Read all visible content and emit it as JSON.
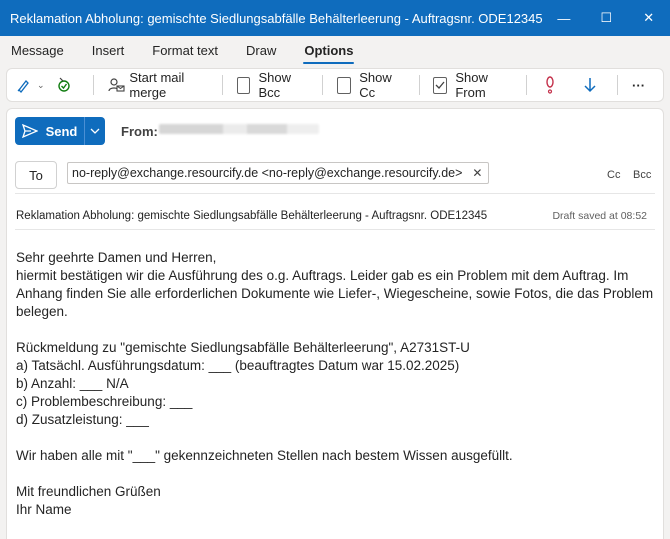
{
  "window": {
    "title": "Reklamation Abholung: gemischte Siedlungsabfälle Behälterleerung - Auftragsnr. ODE12345",
    "controls": {
      "minimize": "—",
      "maximize": "☐",
      "close": "✕"
    }
  },
  "tabs": [
    {
      "label": "Message",
      "active": false
    },
    {
      "label": "Insert",
      "active": false
    },
    {
      "label": "Format text",
      "active": false
    },
    {
      "label": "Draw",
      "active": false
    },
    {
      "label": "Options",
      "active": true
    }
  ],
  "toolbar": {
    "mail_merge_label": "Start mail merge",
    "show_bcc_label": "Show Bcc",
    "show_bcc_checked": false,
    "show_cc_label": "Show Cc",
    "show_cc_checked": false,
    "show_from_label": "Show From",
    "show_from_checked": true,
    "more_label": "···",
    "colors": {
      "importance_high": "#c4314b",
      "importance_low": "#0f6cbd"
    }
  },
  "compose": {
    "send_label": "Send",
    "from_label": "From:",
    "to_label": "To",
    "recipient": "no-reply@exchange.resourcify.de <no-reply@exchange.resourcify.de>",
    "cc_label": "Cc",
    "bcc_label": "Bcc",
    "subject": "Reklamation Abholung: gemischte Siedlungsabfälle Behälterleerung - Auftragsnr. ODE12345",
    "draft_status": "Draft saved at 08:52"
  },
  "body": {
    "greeting": "Sehr geehrte Damen und Herren,",
    "para1_line1": "hiermit bestätigen wir die Ausführung des o.g. Auftrags. Leider gab es ein Problem mit dem Auftrag. Im",
    "para1_line2": "Anhang finden Sie alle erforderlichen Dokumente wie Liefer-, Wiegescheine, sowie Fotos, die das Problem",
    "para1_line3": "belegen.",
    "feedback_title": "Rückmeldung zu \"gemischte Siedlungsabfälle Behälterleerung\", A2731ST-U",
    "item_a": "a) Tatsächl. Ausführungsdatum: ___ (beauftragtes Datum war 15.02.2025)",
    "item_b": "b) Anzahl: ___ N/A",
    "item_c": "c) Problembeschreibung: ___",
    "item_d": "d) Zusatzleistung: ___",
    "note": "Wir haben alle mit \"___\" gekennzeichneten Stellen nach bestem Wissen ausgefüllt.",
    "closing": "Mit freundlichen Grüßen",
    "signature": "Ihr Name"
  }
}
